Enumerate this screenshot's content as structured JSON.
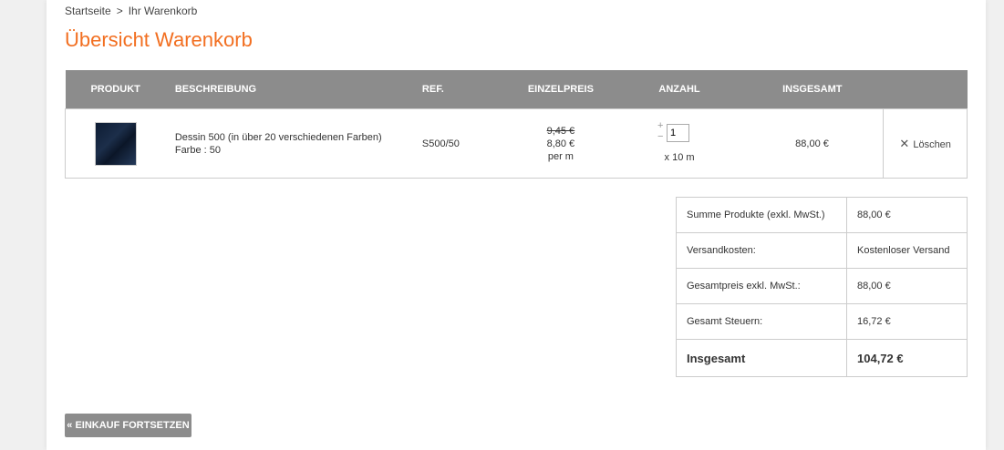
{
  "breadcrumb": {
    "home": "Startseite",
    "separator": ">",
    "current": "Ihr Warenkorb"
  },
  "page_title": "Übersicht Warenkorb",
  "cart": {
    "headers": {
      "produkt": "PRODUKT",
      "beschreibung": "BESCHREIBUNG",
      "ref": "REF.",
      "einzelpreis": "EINZELPREIS",
      "anzahl": "ANZAHL",
      "insgesamt": "INSGESAMT"
    },
    "items": [
      {
        "thumbnail_icon": "fabric-thumbnail",
        "name": "Dessin 500 (in über 20 verschiedenen Farben)",
        "variant": "Farbe : 50",
        "ref": "S500/50",
        "old_price": "9,45 €",
        "price": "8,80 €",
        "price_unit": "per m",
        "qty_plus": "+",
        "qty_minus": "−",
        "quantity": "1",
        "qty_unit": "x 10 m",
        "total": "88,00 €",
        "delete_label": "Löschen"
      }
    ]
  },
  "summary": {
    "rows": [
      {
        "label": "Summe Produkte (exkl. MwSt.)",
        "value": "88,00 €"
      },
      {
        "label": "Versandkosten:",
        "value": "Kostenloser Versand"
      },
      {
        "label": "Gesamtpreis exkl. MwSt.:",
        "value": "88,00 €"
      },
      {
        "label": "Gesamt Steuern:",
        "value": "16,72 €"
      }
    ],
    "grand_total_label": "Insgesamt",
    "grand_total_value": "104,72 €"
  },
  "continue_button": "« EINKAUF FORTSETZEN",
  "colors": {
    "accent": "#f26f21",
    "header_bg": "#8c8c8c"
  }
}
